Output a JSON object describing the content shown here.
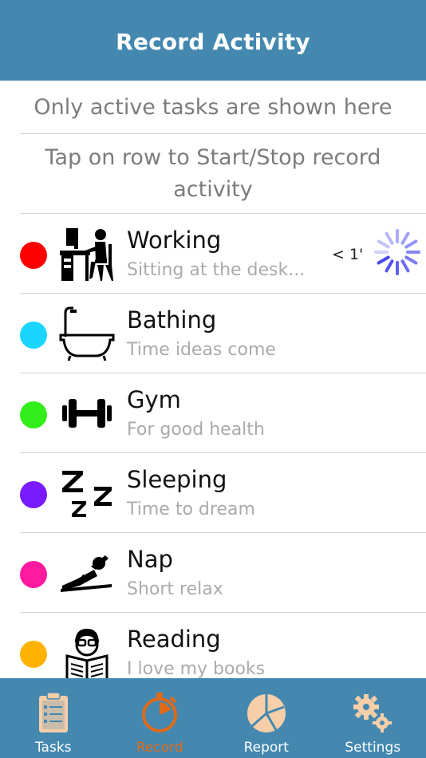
{
  "header": {
    "title": "Record Activity"
  },
  "info": {
    "line1": "Only active tasks are shown here",
    "line2": "Tap on row to Start/Stop record activity"
  },
  "tasks": [
    {
      "name": "Working",
      "description": "Sitting at the desk...",
      "color": "#ff0000",
      "icon": "desk-worker-icon",
      "elapsed": "< 1'",
      "recording": true
    },
    {
      "name": "Bathing",
      "description": "Time ideas come",
      "color": "#1ad6ff",
      "icon": "bathtub-icon"
    },
    {
      "name": "Gym",
      "description": "For good health",
      "color": "#33ee1a",
      "icon": "dumbbell-icon"
    },
    {
      "name": "Sleeping",
      "description": "Time to dream",
      "color": "#7a1aff",
      "icon": "zzz-icon"
    },
    {
      "name": "Nap",
      "description": "Short relax",
      "color": "#ff1aa0",
      "icon": "reclining-person-icon"
    },
    {
      "name": "Reading",
      "description": "I love my books",
      "color": "#ffb300",
      "icon": "reader-icon"
    }
  ],
  "tabbar": {
    "tabs": [
      {
        "label": "Tasks",
        "icon": "clipboard-icon",
        "active": false
      },
      {
        "label": "Record",
        "icon": "stopwatch-icon",
        "active": true
      },
      {
        "label": "Report",
        "icon": "pie-chart-icon",
        "active": false
      },
      {
        "label": "Settings",
        "icon": "gears-icon",
        "active": false
      }
    ]
  },
  "colors": {
    "primary": "#4488b0",
    "active_tab": "#e06a18",
    "inactive_icon": "#f6cfa9",
    "spinner": "#4848ee"
  }
}
